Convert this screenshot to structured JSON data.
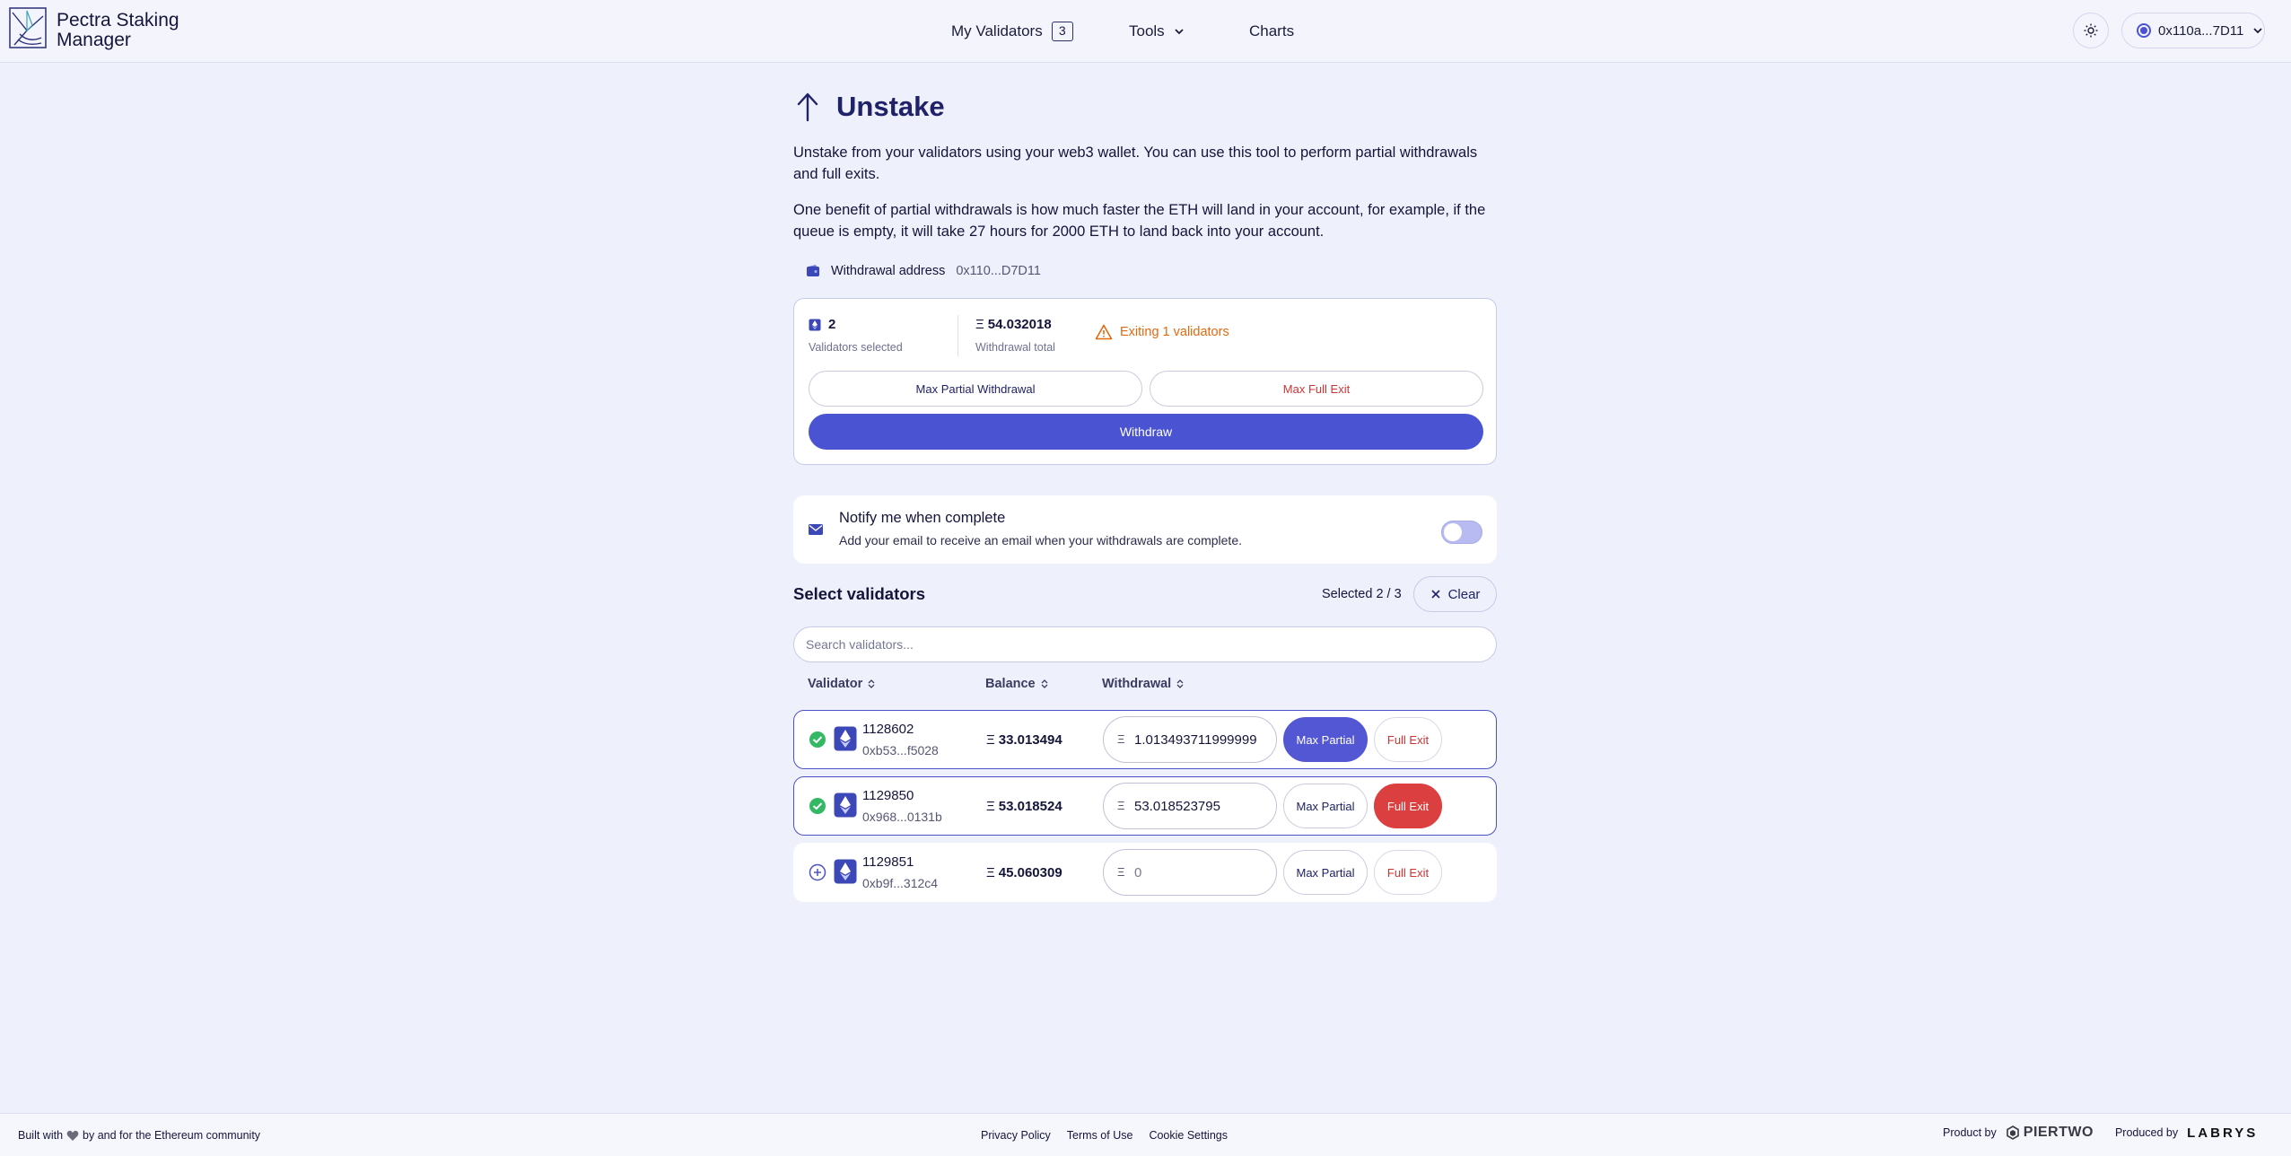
{
  "header": {
    "brand": "Pectra Staking Manager",
    "nav": {
      "validators_label": "My Validators",
      "validators_count": "3",
      "tools_label": "Tools",
      "charts_label": "Charts"
    },
    "wallet": "0x110a...7D11"
  },
  "page": {
    "title": "Unstake",
    "intro_1": "Unstake from your validators using your web3 wallet. You can use this tool to perform partial withdrawals and full exits.",
    "intro_2": "One benefit of partial withdrawals is how much faster the ETH will land in your account, for example, if the queue is empty, it will take 27 hours for 2000 ETH to land back into your account."
  },
  "withdrawal_address": {
    "label": "Withdrawal address",
    "value": "0x110...D7D11"
  },
  "summary": {
    "validators_selected_value": "2",
    "validators_selected_label": "Validators selected",
    "withdrawal_total_value": "54.032018",
    "withdrawal_total_label": "Withdrawal total",
    "warning": "Exiting 1 validators",
    "max_partial_label": "Max Partial Withdrawal",
    "max_full_label": "Max Full Exit",
    "withdraw_label": "Withdraw"
  },
  "notify": {
    "title": "Notify me when complete",
    "subtitle": "Add your email to receive an email when your withdrawals are complete.",
    "enabled": false
  },
  "selection": {
    "title": "Select validators",
    "count": "Selected 2 / 3",
    "clear_label": "Clear",
    "search_placeholder": "Search validators..."
  },
  "table": {
    "headers": {
      "validator": "Validator",
      "balance": "Balance",
      "withdrawal": "Withdrawal"
    },
    "eth_symbol": "Ξ",
    "max_partial_label": "Max Partial",
    "full_exit_label": "Full Exit",
    "rows": [
      {
        "id": "1128602",
        "address": "0xb53...f5028",
        "balance": "33.013494",
        "withdrawal": "1.013493711999999",
        "selected": true,
        "mode": "partial"
      },
      {
        "id": "1129850",
        "address": "0x968...0131b",
        "balance": "53.018524",
        "withdrawal": "53.018523795",
        "selected": true,
        "mode": "full"
      },
      {
        "id": "1129851",
        "address": "0xb9f...312c4",
        "balance": "45.060309",
        "withdrawal": "",
        "withdrawal_placeholder": "0",
        "selected": false,
        "mode": "none"
      }
    ]
  },
  "footer": {
    "built_prefix": "Built with",
    "built_suffix": "by and for the Ethereum community",
    "links": [
      "Privacy Policy",
      "Terms of Use",
      "Cookie Settings"
    ],
    "product_by": "Product by",
    "piertwo": "PIERTWO",
    "produced_by": "Produced by",
    "labrys": "LABRYS"
  },
  "colors": {
    "accent": "#4a53d1",
    "danger": "#dc3f3f",
    "warning": "#e06a10",
    "success": "#33b864",
    "background": "#eef0fb"
  }
}
